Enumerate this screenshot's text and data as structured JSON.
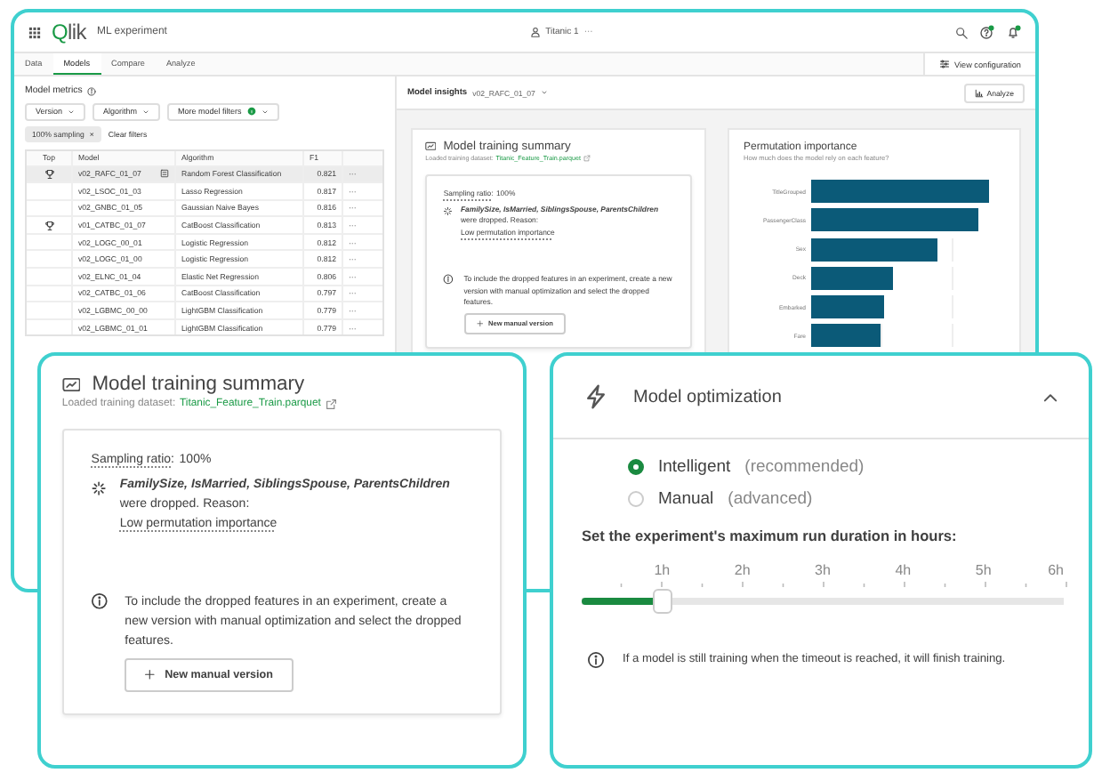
{
  "app": {
    "logo": "Qlik",
    "title": "ML experiment",
    "workspace": "Titanic 1",
    "workspace_menu": "···",
    "tabs": [
      {
        "label": "Data",
        "selected": false
      },
      {
        "label": "Models",
        "selected": true
      },
      {
        "label": "Compare",
        "selected": false
      },
      {
        "label": "Analyze",
        "selected": false
      }
    ],
    "view_configuration": "View configuration",
    "metrics": {
      "title": "Model metrics",
      "filters": [
        {
          "label": "Version",
          "badge": false
        },
        {
          "label": "Algorithm",
          "badge": false
        },
        {
          "label": "More model filters",
          "badge": true
        }
      ],
      "chips": [
        {
          "label": "100% sampling",
          "remove": "×"
        }
      ],
      "clear_filters": "Clear filters",
      "table": {
        "columns": [
          "Top",
          "Model",
          "Algorithm",
          "F1"
        ],
        "rows": [
          {
            "top": true,
            "model": "v02_RAFC_01_07",
            "algorithm": "Random Forest Classification",
            "f1": "0.821",
            "actions": "···",
            "selected": true
          },
          {
            "top": false,
            "model": "v02_LSOC_01_03",
            "algorithm": "Lasso Regression",
            "f1": "0.817",
            "actions": "···",
            "selected": false
          },
          {
            "top": false,
            "model": "v02_GNBC_01_05",
            "algorithm": "Gaussian Naive Bayes",
            "f1": "0.816",
            "actions": "···",
            "selected": false
          },
          {
            "top": true,
            "model": "v01_CATBC_01_07",
            "algorithm": "CatBoost Classification",
            "f1": "0.813",
            "actions": "···",
            "selected": false
          },
          {
            "top": false,
            "model": "v02_LOGC_00_01",
            "algorithm": "Logistic Regression",
            "f1": "0.812",
            "actions": "···",
            "selected": false
          },
          {
            "top": false,
            "model": "v02_LOGC_01_00",
            "algorithm": "Logistic Regression",
            "f1": "0.812",
            "actions": "···",
            "selected": false
          },
          {
            "top": false,
            "model": "v02_ELNC_01_04",
            "algorithm": "Elastic Net Regression",
            "f1": "0.806",
            "actions": "···",
            "selected": false
          },
          {
            "top": false,
            "model": "v02_CATBC_01_06",
            "algorithm": "CatBoost Classification",
            "f1": "0.797",
            "actions": "···",
            "selected": false
          },
          {
            "top": false,
            "model": "v02_LGBMC_00_00",
            "algorithm": "LightGBM Classification",
            "f1": "0.779",
            "actions": "···",
            "selected": false
          },
          {
            "top": false,
            "model": "v02_LGBMC_01_01",
            "algorithm": "LightGBM Classification",
            "f1": "0.779",
            "actions": "···",
            "selected": false
          }
        ]
      }
    },
    "insights": {
      "title": "Model insights",
      "model": "v02_RAFC_01_07",
      "analyze": "Analyze",
      "summary": {
        "title": "Model training summary",
        "dataset_label": "Loaded training dataset:",
        "dataset": "Titanic_Feature_Train.parquet",
        "sampling_label": "Sampling ratio:",
        "sampling_value": "100%",
        "dropped_features": "FamilySize, IsMarried, SiblingsSpouse, ParentsChildren",
        "dropped_text": "were dropped. Reason:",
        "reason": "Low permutation importance",
        "note": "To include the dropped features in an experiment, create a new version with manual optimization and select the dropped features.",
        "button": "New manual version"
      },
      "importance": {
        "title": "Permutation importance",
        "subtitle": "How much does the model rely on each feature?",
        "features": [
          "TitleGrouped",
          "PassengerClass",
          "Sex",
          "Deck",
          "Embarked",
          "Fare"
        ]
      }
    }
  },
  "summary_callout": {
    "title": "Model training summary",
    "dataset_label": "Loaded training dataset:",
    "dataset": "Titanic_Feature_Train.parquet",
    "sampling_label": "Sampling ratio:",
    "sampling_value": "100%",
    "dropped_features": "FamilySize, IsMarried, SiblingsSpouse, ParentsChildren",
    "dropped_text": "were dropped. Reason:",
    "reason": "Low permutation importance",
    "note": "To include the dropped features in an experiment, create a new version with manual optimization and select the dropped features.",
    "button": "New manual version"
  },
  "optimization": {
    "title": "Model optimization",
    "expanded": true,
    "options": [
      {
        "label": "Intelligent",
        "hint": "(recommended)",
        "selected": true
      },
      {
        "label": "Manual",
        "hint": "(advanced)",
        "selected": false
      }
    ],
    "duration_label": "Set the experiment's maximum run duration in hours:",
    "duration": {
      "ticks": [
        "1h",
        "2h",
        "3h",
        "4h",
        "5h",
        "6h"
      ],
      "level": 0.167
    },
    "note": "If a model is still training when the timeout is reached, it will finish training."
  }
}
